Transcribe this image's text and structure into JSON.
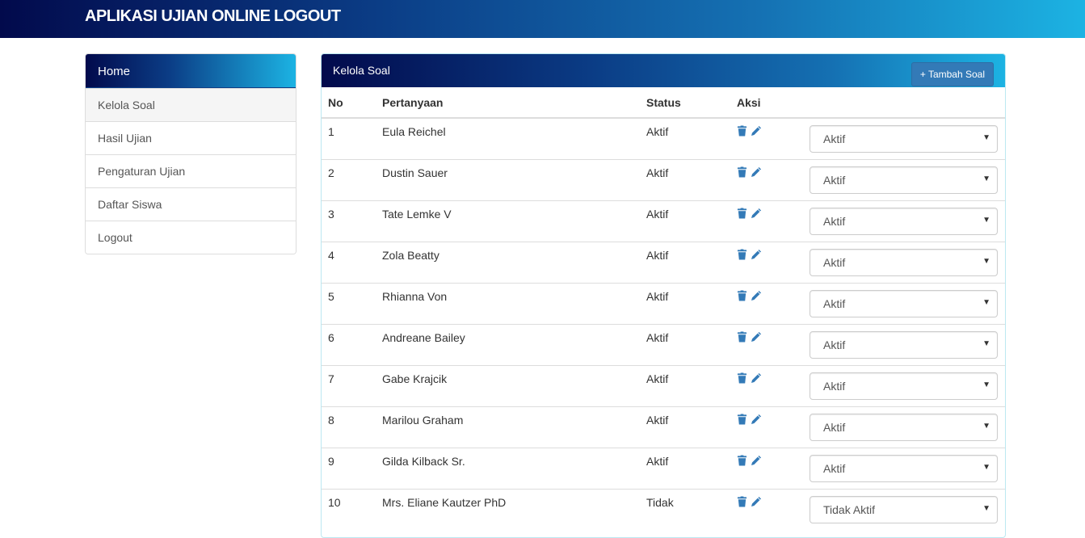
{
  "header": {
    "brand": "APLIKASI UJIAN ONLINE",
    "logout": "LOGOUT"
  },
  "sidebar": {
    "head": "Home",
    "items": [
      {
        "label": "Kelola Soal",
        "active": true
      },
      {
        "label": "Hasil Ujian"
      },
      {
        "label": "Pengaturan Ujian"
      },
      {
        "label": "Daftar Siswa"
      },
      {
        "label": "Logout"
      }
    ]
  },
  "panel": {
    "title": "Kelola Soal",
    "add_button": "+ Tambah Soal",
    "columns": {
      "no": "No",
      "question": "Pertanyaan",
      "status": "Status",
      "actions": "Aksi"
    },
    "rows": [
      {
        "no": "1",
        "question": "Eula Reichel",
        "status": "Aktif",
        "select": "Aktif"
      },
      {
        "no": "2",
        "question": "Dustin Sauer",
        "status": "Aktif",
        "select": "Aktif"
      },
      {
        "no": "3",
        "question": "Tate Lemke V",
        "status": "Aktif",
        "select": "Aktif"
      },
      {
        "no": "4",
        "question": "Zola Beatty",
        "status": "Aktif",
        "select": "Aktif"
      },
      {
        "no": "5",
        "question": "Rhianna Von",
        "status": "Aktif",
        "select": "Aktif"
      },
      {
        "no": "6",
        "question": "Andreane Bailey",
        "status": "Aktif",
        "select": "Aktif"
      },
      {
        "no": "7",
        "question": "Gabe Krajcik",
        "status": "Aktif",
        "select": "Aktif"
      },
      {
        "no": "8",
        "question": "Marilou Graham",
        "status": "Aktif",
        "select": "Aktif"
      },
      {
        "no": "9",
        "question": "Gilda Kilback Sr.",
        "status": "Aktif",
        "select": "Aktif"
      },
      {
        "no": "10",
        "question": "Mrs. Eliane Kautzer PhD",
        "status": "Tidak",
        "select": "Tidak Aktif"
      }
    ]
  },
  "colors": {
    "gradient_start": "#020a4c",
    "gradient_end": "#1cb3e3",
    "icon": "#337ab7",
    "button": "#337ab7"
  },
  "icons": {
    "delete": "trash-icon",
    "edit": "pencil-icon",
    "select": "chevron-down-icon"
  }
}
